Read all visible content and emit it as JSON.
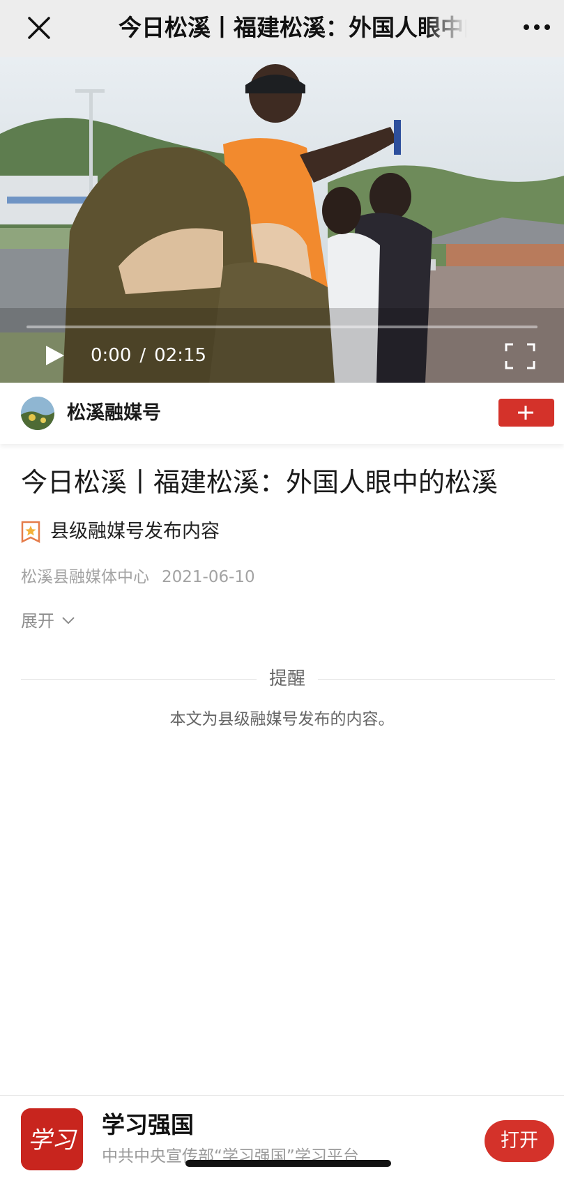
{
  "topbar": {
    "title": "今日松溪丨福建松溪：外国人眼中的松溪",
    "close_icon": "close-icon",
    "more_icon": "more-icon"
  },
  "video": {
    "current_time": "0:00",
    "separator": "/",
    "duration": "02:15",
    "progress": 0,
    "play_icon": "play-icon",
    "fullscreen_icon": "fullscreen-icon"
  },
  "author": {
    "name": "松溪融媒号",
    "follow_icon": "plus-icon",
    "accent": "#d4322a"
  },
  "article": {
    "title": "今日松溪丨福建松溪：外国人眼中的松溪",
    "tag": "县级融媒号发布内容",
    "source": "松溪县融媒体中心",
    "date": "2021-06-10",
    "expand_label": "展开"
  },
  "reminder": {
    "title": "提醒",
    "text": "本文为县级融媒号发布的内容。"
  },
  "banner": {
    "app_name": "学习强国",
    "app_desc": "中共中央宣传部“学习强国”学习平台",
    "open_label": "打开",
    "logo_text": "学习",
    "brand_color": "#c8251e"
  }
}
